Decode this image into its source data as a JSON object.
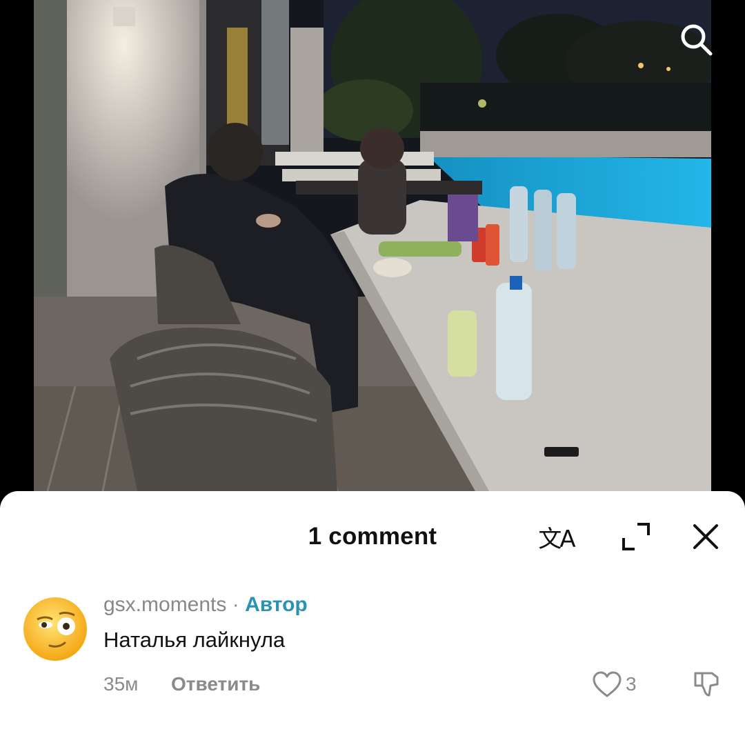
{
  "video": {
    "description_icon": "search-icon"
  },
  "comments_sheet": {
    "title": "1 comment",
    "actions": {
      "translate_icon": "translate-icon",
      "expand_icon": "expand-icon",
      "close_icon": "close-icon"
    },
    "comments": [
      {
        "username": "gsx.moments",
        "separator": "·",
        "badge": "Автор",
        "text": "Наталья лайкнула",
        "time": "35м",
        "reply_label": "Ответить",
        "like_count": "3",
        "avatar_icon": "emoji-avatar"
      }
    ]
  },
  "colors": {
    "sheet_bg": "#ffffff",
    "author_badge": "#2a93b3",
    "muted_text": "#8a8a8a",
    "pool": "#1aa6d6"
  }
}
